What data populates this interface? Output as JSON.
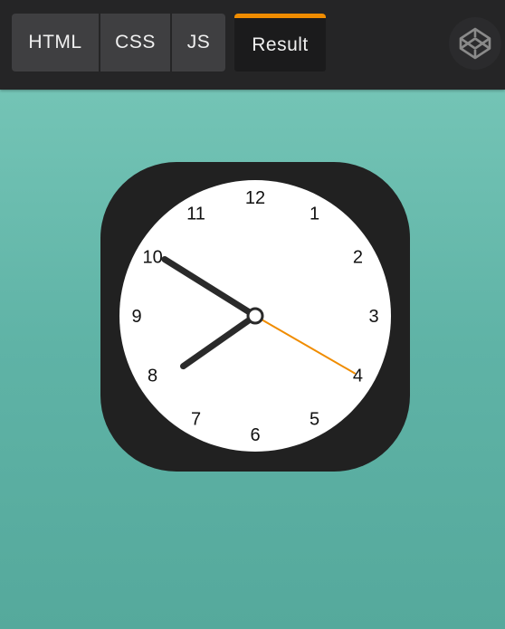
{
  "editor_tabs": {
    "html": "HTML",
    "css": "CSS",
    "js": "JS",
    "result": "Result",
    "active": "Result"
  },
  "colors": {
    "accent": "#f08c00",
    "toolbar_bg": "#252526",
    "clock_frame": "#212121",
    "second_hand": "#f08c00"
  },
  "icons": {
    "codepen": "codepen-logo-icon"
  },
  "clock": {
    "numbers": [
      "12",
      "1",
      "2",
      "3",
      "4",
      "5",
      "6",
      "7",
      "8",
      "9",
      "10",
      "11"
    ],
    "time": {
      "hour": 7,
      "minute": 50,
      "second": 20
    }
  }
}
